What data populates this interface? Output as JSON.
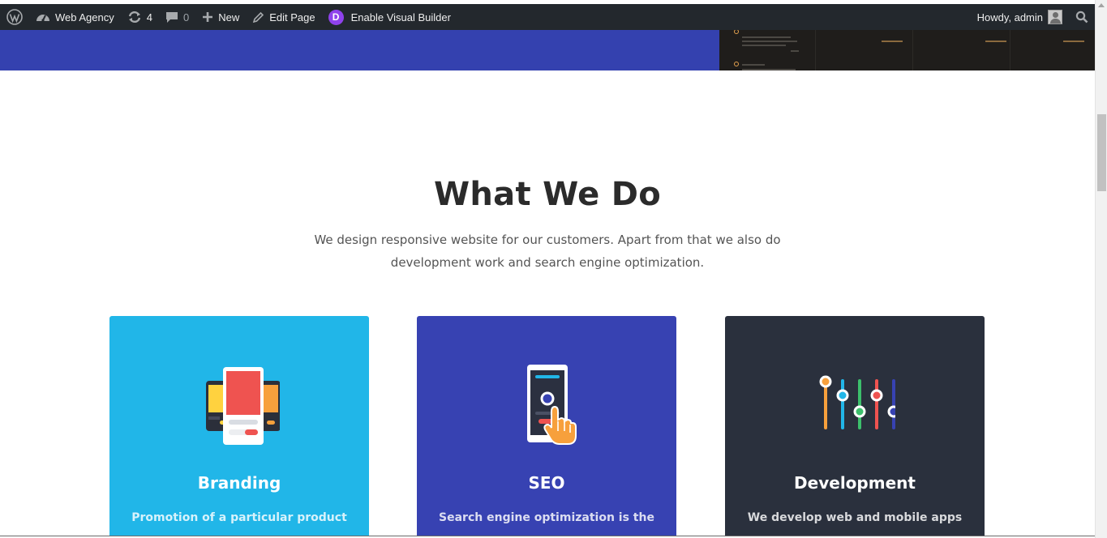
{
  "adminbar": {
    "site_name": "Web Agency",
    "updates_count": "4",
    "comments_count": "0",
    "new_label": "New",
    "edit_page_label": "Edit Page",
    "divi_letter": "D",
    "visual_builder_label": "Enable Visual Builder",
    "howdy_label": "Howdy, admin"
  },
  "section": {
    "title": "What We Do",
    "subtitle": "We design responsive website for our customers. Apart from that we also do development work and search engine optimization."
  },
  "cards": [
    {
      "title": "Branding",
      "text": "Promotion of a particular product",
      "color": "#21b6e8",
      "icon": "branding-icon"
    },
    {
      "title": "SEO",
      "text": "Search engine optimization is the",
      "color": "#3742b2",
      "icon": "seo-icon"
    },
    {
      "title": "Development",
      "text": "We develop web and mobile apps",
      "color": "#2a303d",
      "icon": "development-icon"
    }
  ],
  "colors": {
    "adminbar": "#23282d",
    "hero_blue": "#3441af",
    "title": "#2b2b2b",
    "accent_orange": "#f7a03c"
  }
}
